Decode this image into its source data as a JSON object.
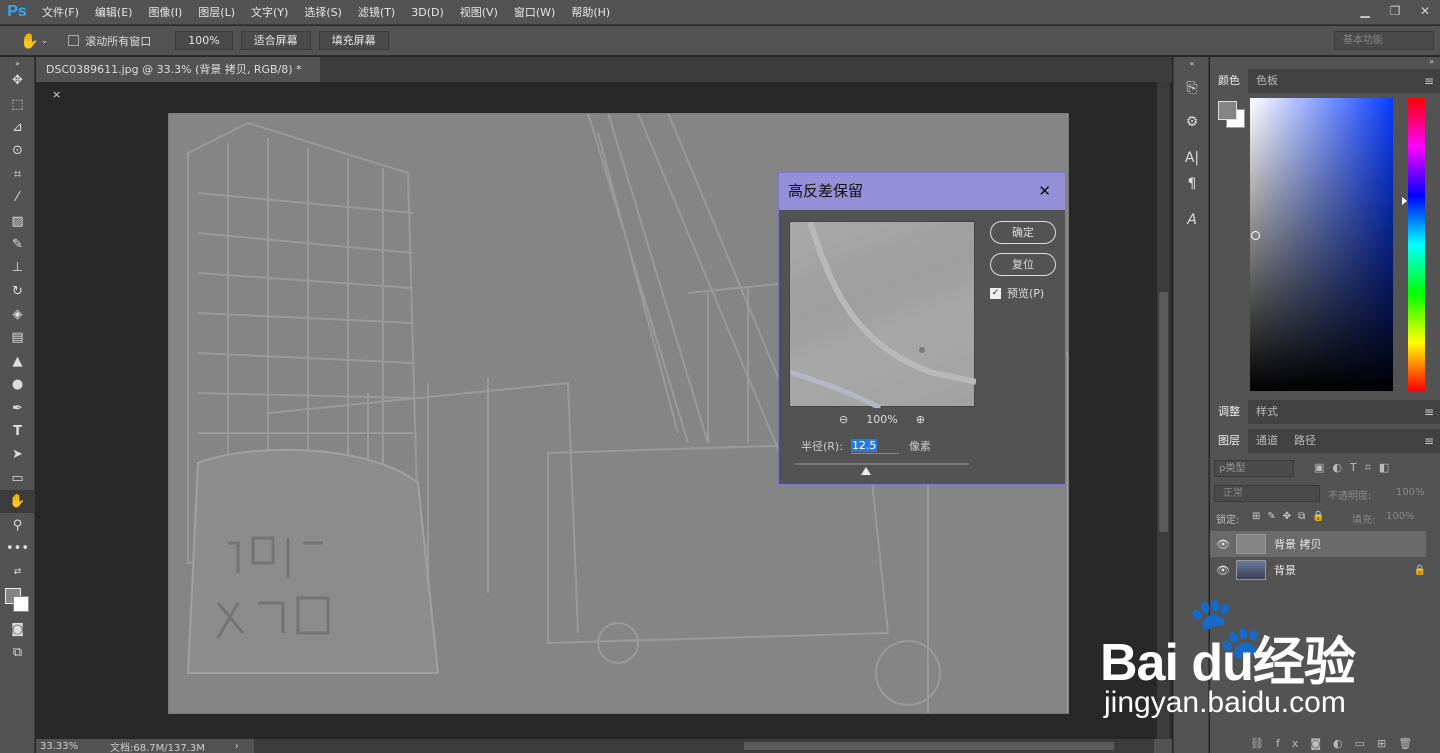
{
  "app": {
    "logo": "Ps"
  },
  "menu": [
    "文件(F)",
    "编辑(E)",
    "图像(I)",
    "图层(L)",
    "文字(Y)",
    "选择(S)",
    "滤镜(T)",
    "3D(D)",
    "视图(V)",
    "窗口(W)",
    "帮助(H)"
  ],
  "options": {
    "scroll_all": "滚动所有窗口",
    "zoom_btn": "100%",
    "fit_btn": "适合屏幕",
    "fill_btn": "填充屏幕",
    "workspace": "基本功能"
  },
  "document": {
    "tab_title": "DSC0389611.jpg @ 33.3% (背景 拷贝, RGB/8) *",
    "zoom_status": "33.33%",
    "doc_status": "文档:68.7M/137.3M"
  },
  "dialog": {
    "title": "高反差保留",
    "ok": "确定",
    "reset": "复位",
    "preview_label": "预览(P)",
    "preview_checked": true,
    "zoom": "100%",
    "radius_label": "半径(R):",
    "radius_value": "12.5",
    "radius_unit": "像素"
  },
  "color_panel": {
    "tabs": [
      "颜色",
      "色板"
    ],
    "fg": "#858585",
    "bg": "#ffffff"
  },
  "adjust_panel": {
    "tabs": [
      "调整",
      "样式"
    ]
  },
  "layers_panel": {
    "tabs": [
      "图层",
      "通道",
      "路径"
    ],
    "kind_filter": "ρ类型",
    "blend_mode": "正常",
    "opacity_label": "不透明度:",
    "opacity_value": "100%",
    "lock_label": "锁定:",
    "fill_label": "填充:",
    "fill_value": "100%",
    "layers": [
      {
        "name": "背景 拷贝",
        "selected": true
      },
      {
        "name": "背景",
        "selected": false
      }
    ]
  },
  "watermark": {
    "brand": "Bai du经验",
    "url": "jingyan.baidu.com"
  }
}
